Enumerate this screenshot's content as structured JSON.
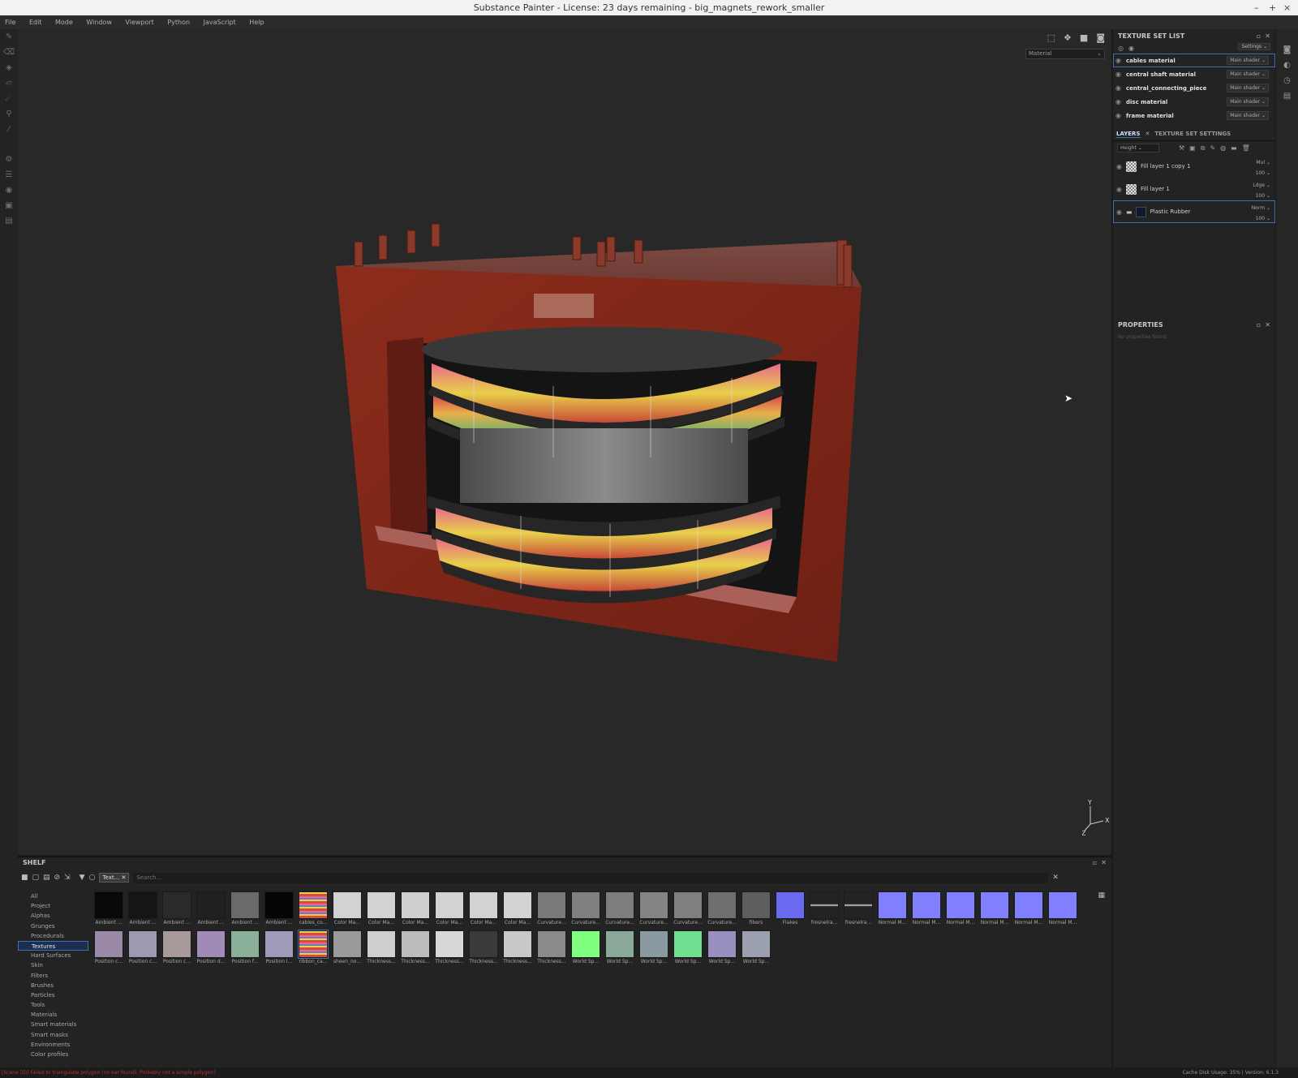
{
  "window": {
    "title": "Substance Painter - License: 23 days remaining - big_magnets_rework_smaller",
    "controls": [
      "–",
      "+",
      "×"
    ]
  },
  "menu": [
    "File",
    "Edit",
    "Mode",
    "Window",
    "Viewport",
    "Python",
    "JavaScript",
    "Help"
  ],
  "left_tools": [
    "paint-brush-icon",
    "eraser-icon",
    "projection-icon",
    "polygon-fill-icon",
    "smudge-icon",
    "clone-icon",
    "color-picker-icon",
    "settings-icon",
    "layers-icon",
    "bake-icon",
    "python-icon",
    "log-icon"
  ],
  "viewport": {
    "material_mode": "Material",
    "axis": {
      "x": "X",
      "y": "Y",
      "z": "Z"
    }
  },
  "texture_set_list": {
    "title": "TEXTURE SET LIST",
    "settings_label": "Settings",
    "items": [
      {
        "name": "cables material",
        "shader": "Main shader"
      },
      {
        "name": "central shaft material",
        "shader": "Main shader"
      },
      {
        "name": "central_connecting_piece",
        "shader": "Main shader"
      },
      {
        "name": "disc material",
        "shader": "Main shader"
      },
      {
        "name": "frame material",
        "shader": "Main shader"
      }
    ]
  },
  "layers": {
    "tabs": [
      "LAYERS",
      "TEXTURE SET SETTINGS"
    ],
    "channel": "Height",
    "items": [
      {
        "name": "Fill layer 1 copy 1",
        "blend": "Mul",
        "opacity": "100"
      },
      {
        "name": "Fill layer 1",
        "blend": "Ldge",
        "opacity": "100"
      },
      {
        "name": "Plastic Rubber",
        "blend": "Norm",
        "opacity": "100"
      }
    ]
  },
  "properties": {
    "title": "PROPERTIES",
    "empty": "No properties found"
  },
  "shelf": {
    "title": "SHELF",
    "filter_chip": "Text...",
    "search_placeholder": "Search...",
    "categories": [
      "All",
      "Project",
      "Alphas",
      "Grunges",
      "Procedurals",
      "Textures",
      "Hard Surfaces",
      "Skin",
      "Filters",
      "Brushes",
      "Particles",
      "Tools",
      "Materials",
      "Smart materials",
      "Smart masks",
      "Environments",
      "Color profiles"
    ],
    "selected_category": "Textures",
    "thumbs": [
      {
        "label": "Ambient ...",
        "color": "#080808"
      },
      {
        "label": "Ambient ...",
        "color": "#151515"
      },
      {
        "label": "Ambient ...",
        "color": "#2a2a2a"
      },
      {
        "label": "Ambient ...",
        "color": "#202020"
      },
      {
        "label": "Ambient ...",
        "color": "#6a6a6a"
      },
      {
        "label": "Ambient ...",
        "color": "#050505"
      },
      {
        "label": "cables_co...",
        "color": "#d8443a"
      },
      {
        "label": "Color Ma...",
        "color": "#d2d2d2"
      },
      {
        "label": "Color Ma...",
        "color": "#d2d2d2"
      },
      {
        "label": "Color Ma...",
        "color": "#cfcfcf"
      },
      {
        "label": "Color Ma...",
        "color": "#d2d2d2"
      },
      {
        "label": "Color Ma...",
        "color": "#d2d2d2"
      },
      {
        "label": "Color Ma...",
        "color": "#d2d2d2"
      },
      {
        "label": "Curvature...",
        "color": "#7a7a7a"
      },
      {
        "label": "Curvature...",
        "color": "#808080"
      },
      {
        "label": "Curvature...",
        "color": "#7d7d7d"
      },
      {
        "label": "Curvature...",
        "color": "#848484"
      },
      {
        "label": "Curvature...",
        "color": "#7f7f7f"
      },
      {
        "label": "Curvature...",
        "color": "#6f6f6f"
      },
      {
        "label": "fibers",
        "color": "#5e5e5e"
      },
      {
        "label": "Flakes",
        "color": "#6a6af0"
      },
      {
        "label": "fresnelra...",
        "color": "#222222"
      },
      {
        "label": "fresnelra...",
        "color": "#262626"
      },
      {
        "label": "Normal M...",
        "color": "#8080ff"
      },
      {
        "label": "Normal M...",
        "color": "#8080ff"
      },
      {
        "label": "Normal M...",
        "color": "#8080ff"
      },
      {
        "label": "Normal M...",
        "color": "#8080ff"
      },
      {
        "label": "Normal M...",
        "color": "#8080ff"
      },
      {
        "label": "Normal M...",
        "color": "#8080ff"
      },
      {
        "label": "Position c...",
        "color": "#9a8aa8"
      },
      {
        "label": "Position c...",
        "color": "#9c9ab0"
      },
      {
        "label": "Position c...",
        "color": "#a89a9a"
      },
      {
        "label": "Position d...",
        "color": "#a08ab8"
      },
      {
        "label": "Position f...",
        "color": "#8ab09a"
      },
      {
        "label": "Position l...",
        "color": "#a09ab8"
      },
      {
        "label": "ribbon_ca...",
        "color": "#c87a5a"
      },
      {
        "label": "sheen_no...",
        "color": "#9a9a9a"
      },
      {
        "label": "Thickness...",
        "color": "#cfcfcf"
      },
      {
        "label": "Thickness...",
        "color": "#bcbcbc"
      },
      {
        "label": "Thickness...",
        "color": "#d8d8d8"
      },
      {
        "label": "Thickness...",
        "color": "#3a3a3a"
      },
      {
        "label": "Thickness...",
        "color": "#c8c8c8"
      },
      {
        "label": "Thickness...",
        "color": "#8a8a8a"
      },
      {
        "label": "World Sp...",
        "color": "#80ff80"
      },
      {
        "label": "World Sp...",
        "color": "#8aa89a"
      },
      {
        "label": "World Sp...",
        "color": "#8a9aa0"
      },
      {
        "label": "World Sp...",
        "color": "#70e090"
      },
      {
        "label": "World Sp...",
        "color": "#9a90c0"
      },
      {
        "label": "World Sp...",
        "color": "#9aa0b0"
      }
    ],
    "selected_thumb": "ribbon_ca..."
  },
  "status": {
    "message": "[Scene 3D] Failed to triangulate polygon (no ear found). Probably not a simple polygon?",
    "right": "Cache Disk Usage:   35% | Version: 6.1.3"
  },
  "colors": {
    "accent": "#3d6fb8",
    "frame": "#8a2a1c"
  }
}
